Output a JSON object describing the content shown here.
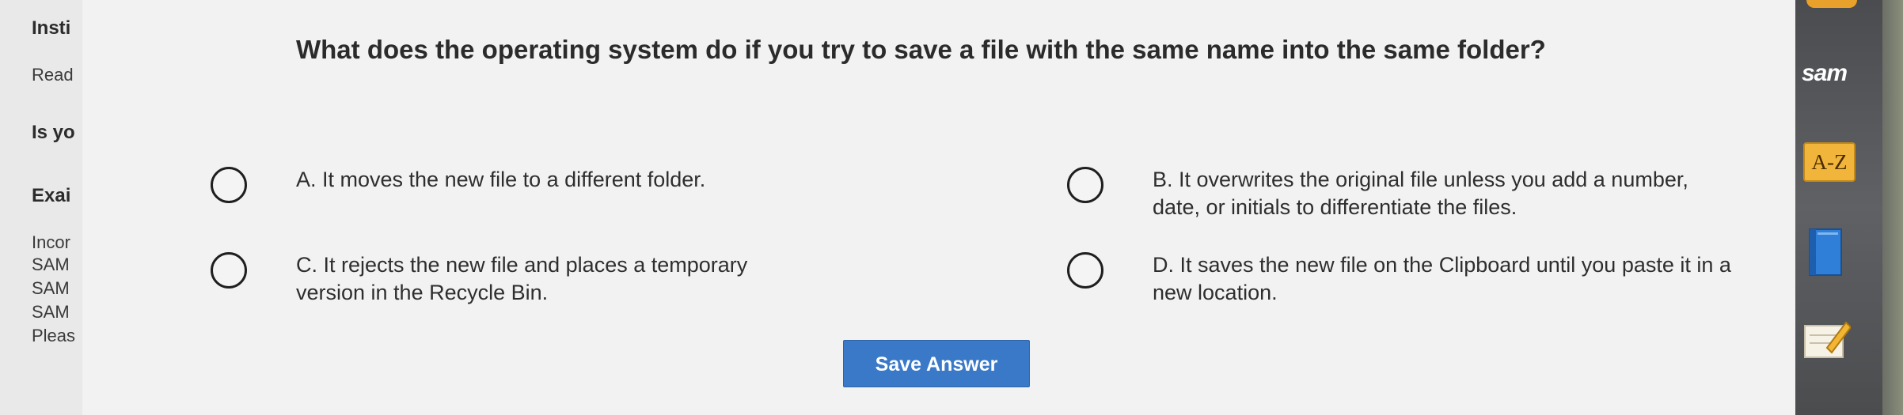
{
  "background_left": {
    "heading1": "Insti",
    "line_read": "Read",
    "heading2": "Is yo",
    "heading3": "Exai",
    "lines": [
      "Incor",
      "SAM",
      "SAM",
      "SAM",
      "Pleas"
    ]
  },
  "question": "What does the operating system do if you try to save a file with the same name into the same folder?",
  "options": [
    {
      "text": "A. It moves the new file to a different folder."
    },
    {
      "text": "B. It overwrites the original file unless you add a number, date, or initials to differentiate the files."
    },
    {
      "text": "C. It rejects the new file and places a temporary version in the Recycle Bin."
    },
    {
      "text": "D. It saves the new file on the Clipboard until you paste it in a new location."
    }
  ],
  "save_button": "Save Answer",
  "right_toolbar": {
    "logo": "sam",
    "az_label": "A-Z",
    "icons": [
      "az-dictionary-icon",
      "book-icon",
      "notepad-icon"
    ]
  },
  "colors": {
    "accent_button": "#3a78c8",
    "modal_bg": "#f2f2f3",
    "az_icon": "#f0b53a"
  }
}
